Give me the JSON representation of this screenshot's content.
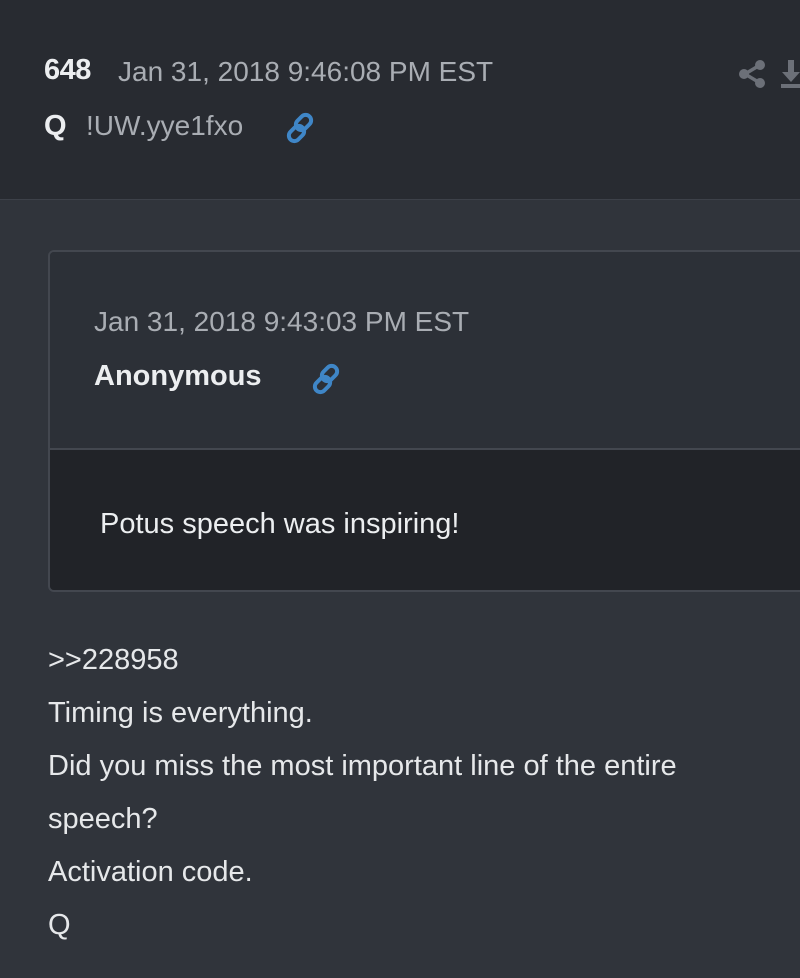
{
  "post": {
    "number": "648",
    "date": "Jan 31, 2018 9:46:08 PM EST",
    "author": "Q",
    "tripcode": "!UW.yye1fxo",
    "icons": {
      "link": "link-icon",
      "share": "share-icon",
      "download": "download-icon"
    }
  },
  "quoted": {
    "date": "Jan 31, 2018 9:43:03 PM EST",
    "author": "Anonymous",
    "text": "Potus speech was inspiring!",
    "icons": {
      "link": "link-icon"
    }
  },
  "message": {
    "lines": [
      ">>228958",
      "Timing is everything.",
      "Did you miss the most important line of the entire",
      "speech?",
      "Activation code.",
      "Q"
    ]
  },
  "colors": {
    "background": "#30343b",
    "header_background": "#282b31",
    "quote_body_background": "#212328",
    "link_accent": "#3f86c7",
    "muted_text": "#a9adb3"
  }
}
